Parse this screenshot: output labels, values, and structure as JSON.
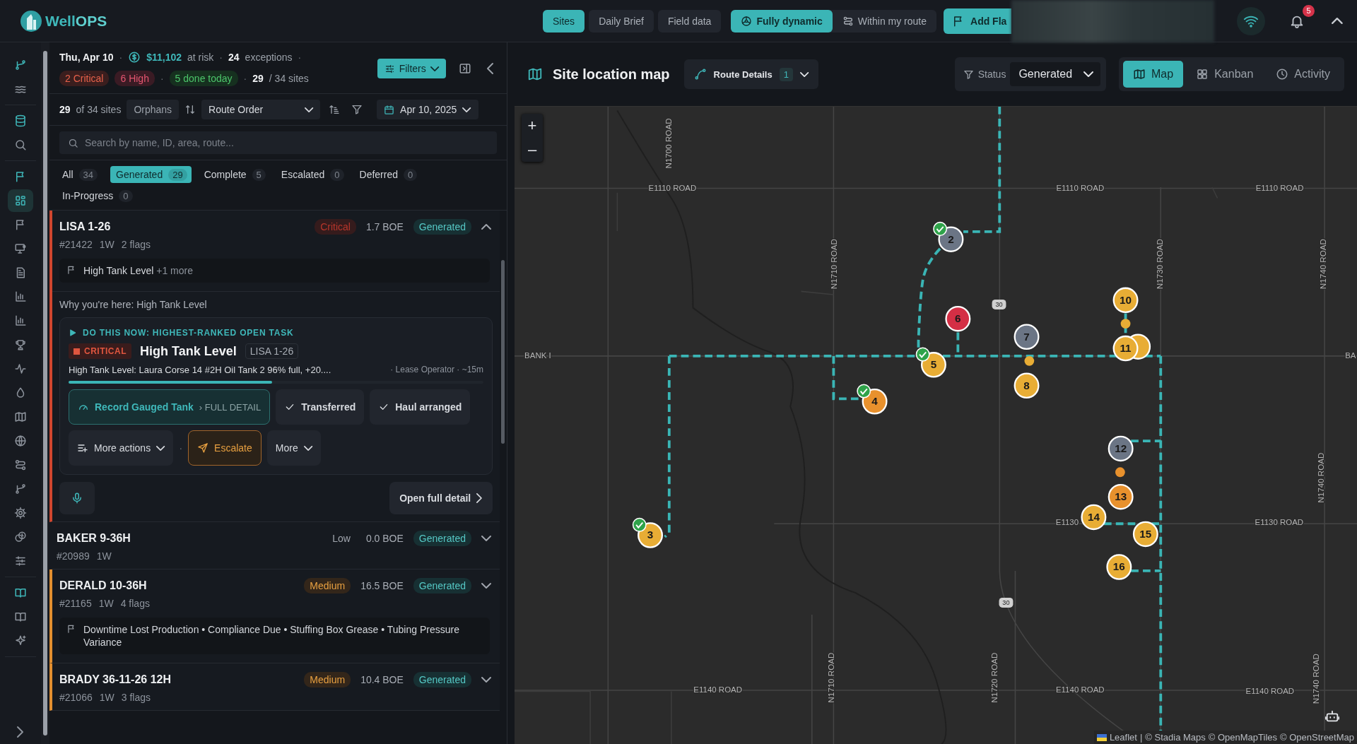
{
  "topbar": {
    "logo": {
      "first": "Well",
      "second": "OPS"
    },
    "nav": [
      {
        "label": "Sites",
        "selected": true
      },
      {
        "label": "Daily Brief",
        "selected": false
      },
      {
        "label": "Field data",
        "selected": false
      }
    ],
    "mode": [
      {
        "label": "Fully dynamic",
        "selected": true
      },
      {
        "label": "Within my route",
        "selected": false
      }
    ],
    "add_flag": "Add Fla",
    "notifications": "5"
  },
  "rail_groups": [
    {
      "items": [
        {
          "selected": false,
          "accent": true
        },
        {
          "selected": false,
          "accent": false
        }
      ]
    },
    {
      "items": [
        {
          "selected": false,
          "accent": true
        },
        {
          "selected": false,
          "accent": false
        }
      ]
    },
    {
      "items": [
        {
          "selected": false,
          "accent": true
        },
        {
          "selected": true,
          "accent": true
        },
        {
          "selected": false,
          "accent": false
        },
        {
          "selected": false,
          "accent": false
        },
        {
          "selected": false,
          "accent": false
        },
        {
          "selected": false,
          "accent": false
        },
        {
          "selected": false,
          "accent": false
        },
        {
          "selected": false,
          "accent": false
        },
        {
          "selected": false,
          "accent": false
        },
        {
          "selected": false,
          "accent": false
        },
        {
          "selected": false,
          "accent": false
        },
        {
          "selected": false,
          "accent": false
        },
        {
          "selected": false,
          "accent": false
        },
        {
          "selected": false,
          "accent": false
        },
        {
          "selected": false,
          "accent": false
        },
        {
          "selected": false,
          "accent": false
        },
        {
          "selected": false,
          "accent": false
        }
      ]
    },
    {
      "items": [
        {
          "selected": false,
          "accent": true
        },
        {
          "selected": false,
          "accent": false
        },
        {
          "selected": false,
          "accent": false
        }
      ]
    }
  ],
  "summary": {
    "date": "Thu, Apr 10",
    "risk_amount": "$11,102",
    "risk_label": "at risk",
    "exceptions_count": "24",
    "exceptions_label": "exceptions",
    "separator": "·",
    "pills": [
      {
        "kind": "critical",
        "label": "2 Critical"
      },
      {
        "kind": "high",
        "label": "6 High"
      },
      {
        "kind": "done",
        "label": "5 done today"
      }
    ],
    "sites_done": "29",
    "sites_total": "/ 34 sites",
    "filters": "Filters"
  },
  "toolbar": {
    "shown": "29",
    "of_total": "of 34 sites",
    "orphans": "Orphans",
    "sort": "Route Order",
    "date": "Apr 10, 2025"
  },
  "search": {
    "placeholder": "Search by name, ID, area, route..."
  },
  "status_tabs": [
    {
      "label": "All",
      "count": "34",
      "selected": false
    },
    {
      "label": "Generated",
      "count": "29",
      "selected": true
    },
    {
      "label": "Complete",
      "count": "5",
      "selected": false
    },
    {
      "label": "Escalated",
      "count": "0",
      "selected": false
    },
    {
      "label": "Deferred",
      "count": "0",
      "selected": false
    },
    {
      "label": "In-Progress",
      "count": "0",
      "selected": false
    }
  ],
  "sites": [
    {
      "name": "LISA 1-26",
      "number": "#21422",
      "wells": "1W",
      "flags": "2 flags",
      "priority": {
        "kind": "critical",
        "label": "Critical"
      },
      "boe": "1.7 BOE",
      "status": "Generated",
      "expanded": true,
      "flag_line": {
        "text": "High Tank Level",
        "more": "+1 more"
      },
      "detail": {
        "why": "Why you're here: High Tank Level",
        "task_heading": "DO THIS NOW: HIGHEST-RANKED OPEN TASK",
        "severity": "CRITICAL",
        "title": "High Tank Level",
        "site_tag": "LISA 1-26",
        "description": "High Tank Level: Laura Corse 14 #2H Oil Tank 2 96% full, +20....",
        "meta": "· Lease Operator · ~15m",
        "level": 0.49,
        "primary_action": "Record Gauged Tank",
        "primary_link": "› FULL DETAIL",
        "quick_actions": [
          "Transferred",
          "Haul arranged"
        ],
        "more_actions": "More actions",
        "separator": "·",
        "escalate": "Escalate",
        "more": "More",
        "open_detail": "Open full detail"
      }
    },
    {
      "name": "BAKER 9-36H",
      "number": "#20989",
      "wells": "1W",
      "priority": {
        "kind": "low",
        "label": "Low"
      },
      "boe": "0.0 BOE",
      "status": "Generated",
      "expanded": false
    },
    {
      "name": "DERALD 10-36H",
      "number": "#21165",
      "wells": "1W",
      "flags": "4 flags",
      "priority": {
        "kind": "medium",
        "label": "Medium"
      },
      "boe": "16.5 BOE",
      "status": "Generated",
      "expanded": false,
      "flag_line": {
        "text": "Downtime Lost Production • Compliance Due • Stuffing Box Grease • Tubing Pressure Variance"
      }
    },
    {
      "name": "BRADY 36-11-26 12H",
      "number": "#21066",
      "wells": "1W",
      "flags": "3 flags",
      "priority": {
        "kind": "medium",
        "label": "Medium"
      },
      "boe": "10.4 BOE",
      "status": "Generated",
      "expanded": false
    }
  ],
  "map_header": {
    "title": "Site location map",
    "route_details": "Route Details",
    "route_count": "1",
    "status_label": "Status",
    "status_value": "Generated",
    "views": [
      {
        "label": "Map",
        "selected": true
      },
      {
        "label": "Kanban",
        "selected": false
      },
      {
        "label": "Activity",
        "selected": false
      }
    ]
  },
  "map": {
    "zoom_in": "+",
    "zoom_out": "–",
    "road_labels": [
      "N1700 ROAD",
      "E1110 ROAD",
      "E1110 ROAD",
      "E1110 ROAD",
      "N1710 ROAD",
      "N1730 ROAD",
      "N1740 ROAD",
      "BANK I",
      "BA",
      "N1740 ROAD",
      "E1130",
      "E1130 ROAD",
      "N1710 ROAD",
      "N1720 ROAD",
      "N1740 ROAD",
      "E1140 ROAD",
      "E1140 ROAD",
      "E1140 ROAD"
    ],
    "shields": [
      "30",
      "30"
    ],
    "markers": [
      {
        "label": "2",
        "color": "#6b7585",
        "done": true
      },
      {
        "label": "3",
        "color": "#e8ad35",
        "done": true
      },
      {
        "label": "4",
        "color": "#e8912d",
        "done": true
      },
      {
        "label": "5",
        "color": "#e8ad35",
        "done": true
      },
      {
        "label": "6",
        "color": "#d42f45",
        "done": false
      },
      {
        "label": "7",
        "color": "#6b7585",
        "done": false
      },
      {
        "label": "8",
        "color": "#e8ad35",
        "done": false
      },
      {
        "color": "#e8ad35",
        "done": false
      },
      {
        "label": "10",
        "color": "#e8ad35",
        "done": false
      },
      {
        "label": "11",
        "color": "#e8ad35",
        "done": false
      },
      {
        "label": "12",
        "color": "#6b7585",
        "done": false
      },
      {
        "label": "13",
        "color": "#e8912d",
        "done": false
      },
      {
        "label": "14",
        "color": "#e8ad35",
        "done": false
      },
      {
        "label": "15",
        "color": "#e8ad35",
        "done": false
      },
      {
        "label": "16",
        "color": "#e8ad35",
        "done": false
      }
    ],
    "attribution": {
      "leaflet": "Leaflet",
      "separator": "|",
      "sources": [
        "© Stadia Maps",
        "© OpenMapTiles",
        "© OpenStreetMap"
      ]
    }
  }
}
